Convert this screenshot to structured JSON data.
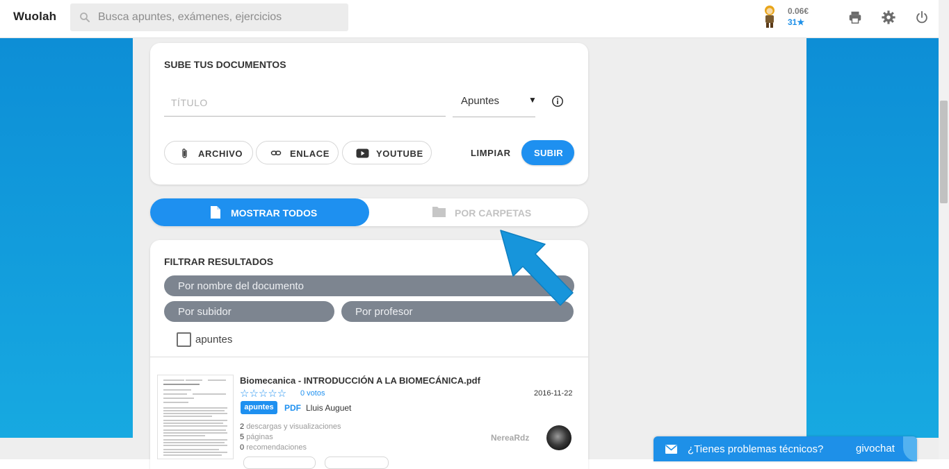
{
  "header": {
    "logo": "Wuolah",
    "search_placeholder": "Busca apuntes, exámenes, ejercicios",
    "balance": "0.06€",
    "stars": "31★",
    "icons": [
      "print-icon",
      "gear-icon",
      "power-icon"
    ]
  },
  "upload": {
    "title": "SUBE TUS DOCUMENTOS",
    "title_placeholder": "TÍTULO",
    "type_value": "Apuntes",
    "type_arrow": "▼",
    "buttons": {
      "archivo": "ARCHIVO",
      "enlace": "ENLACE",
      "youtube": "YOUTUBE",
      "limpiar": "LIMPIAR",
      "subir": "SUBIR"
    }
  },
  "view_toggle": {
    "active": "MOSTRAR TODOS",
    "inactive": "POR CARPETAS"
  },
  "filter": {
    "title": "FILTRAR RESULTADOS",
    "name_placeholder": "Por nombre del documento",
    "uploader_placeholder": "Por subidor",
    "teacher_placeholder": "Por profesor",
    "checkbox_label": "apuntes",
    "checkbox_checked": false
  },
  "documents": [
    {
      "title": "Biomecanica - INTRODUCCIÓN A LA BIOMECÁNICA.pdf",
      "stars": "☆☆☆☆☆",
      "votes": "0 votos",
      "date": "2016-11-22",
      "badge": "apuntes",
      "format": "PDF",
      "teacher": "Lluis Auguet",
      "downloads_count": "2",
      "downloads_label": "descargas y visualizaciones",
      "pages_count": "5",
      "pages_label": "páginas",
      "recs_count": "0",
      "recs_label": "recomendaciones",
      "uploader": "NereaRdz"
    }
  ],
  "chat": {
    "text": "¿Tienes problemas técnicos?",
    "brand": "givochat"
  },
  "colors": {
    "accent": "#1e90f0",
    "side_blue": "#0d8ed6",
    "filter_pill": "#7d8590",
    "background": "#eeeeee"
  }
}
